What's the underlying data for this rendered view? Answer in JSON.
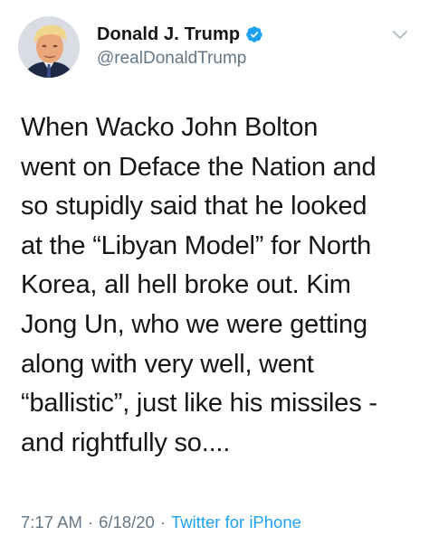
{
  "author": {
    "display_name": "Donald J. Trump",
    "handle": "@realDonaldTrump",
    "verified": true
  },
  "tweet": {
    "text": "When Wacko John Bolton\nwent on Deface the Nation and\nso stupidly said that he looked\nat the “Libyan Model” for North\nKorea, all hell broke out. Kim\nJong Un, who we were getting\nalong with very well, went\n“ballistic”, just like his missiles -\nand rightfully so....",
    "time": "7:17 AM",
    "separator": "·",
    "date": "6/18/20",
    "source": "Twitter for iPhone"
  },
  "icons": {
    "verified": "verified-badge-icon",
    "menu": "chevron-down-icon"
  },
  "colors": {
    "text": "#14171a",
    "secondary": "#657786",
    "accent": "#1da1f2"
  }
}
